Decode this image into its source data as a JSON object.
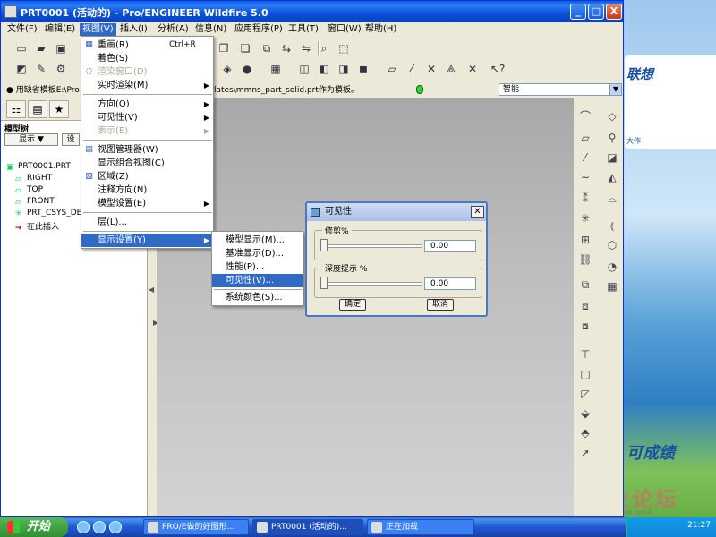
{
  "window": {
    "title": "PRT0001 (活动的) - Pro/ENGINEER Wildfire 5.0",
    "min": "_",
    "max": "□",
    "close": "X"
  },
  "menubar": [
    "文件(F)",
    "编辑(E)",
    "视图(V)",
    "插入(I)",
    "分析(A)",
    "信息(N)",
    "应用程序(P)",
    "工具(T)",
    "窗口(W)",
    "帮助(H)"
  ],
  "message": {
    "text": "● 用缺省模板E:\\Pro",
    "text2": "lates\\mmns_part_solid.prt作为模板。",
    "filter": "智能"
  },
  "left_panel": {
    "title": "模型树",
    "show_button": "显示 ▼",
    "settings_button": "设",
    "tree": [
      "PRT0001.PRT",
      "RIGHT",
      "TOP",
      "FRONT",
      "PRT_CSYS_DEF",
      "在此插入"
    ]
  },
  "view_menu": {
    "items": [
      {
        "label": "重画(R)",
        "shortcut": "Ctrl+R"
      },
      {
        "label": "着色(S)"
      },
      {
        "label": "渲染窗口(D)"
      },
      {
        "label": "实时渲染(M)"
      },
      {
        "label": "方向(O)"
      },
      {
        "label": "可见性(V)"
      },
      {
        "label": "表示(E)"
      },
      {
        "label": "视图管理器(W)"
      },
      {
        "label": "显示组合视图(C)"
      },
      {
        "label": "区域(Z)"
      },
      {
        "label": "注释方向(N)"
      },
      {
        "label": "模型设置(E)"
      },
      {
        "label": "层(L)..."
      },
      {
        "label": "显示设置(Y)"
      }
    ]
  },
  "display_submenu": {
    "items": [
      "模型显示(M)...",
      "基准显示(D)...",
      "性能(P)...",
      "可见性(V)...",
      "系统颜色(S)..."
    ]
  },
  "dialog": {
    "title": "可见性",
    "clip_label": "修剪%",
    "clip_value": "0.00",
    "depth_label": "深度提示 %",
    "depth_value": "0.00",
    "ok": "确定",
    "cancel": "取消"
  },
  "desktop": {
    "banner_title": "联想",
    "banner_sub": "大作",
    "slogan": "可成绩",
    "watermark": "野火论坛",
    "watermark_url": "www.proe"
  },
  "taskbar": {
    "start": "开始",
    "tasks": [
      "PRO/E做的好图形...",
      "PRT0001 (活动的)...",
      "正在加载"
    ],
    "clock": "21:27"
  },
  "colors": {
    "titlebar": "#0a5fe8",
    "selection": "#316ac5",
    "menu_bg": "#ece9d8"
  }
}
